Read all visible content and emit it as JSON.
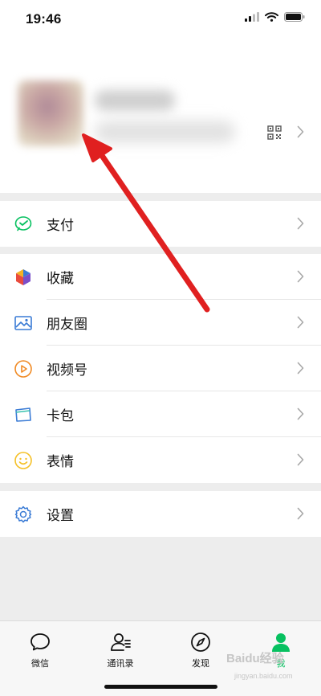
{
  "status_bar": {
    "time": "19:46",
    "icons": [
      "cellular-signal-icon",
      "wifi-icon",
      "battery-icon"
    ]
  },
  "profile": {
    "avatar": "blurred-avatar",
    "name_obscured": true,
    "icons": [
      "qr-code-icon",
      "chevron-right-icon"
    ]
  },
  "menu": {
    "pay": {
      "label": "支付",
      "icon": "wechat-pay-icon"
    },
    "favorites": {
      "label": "收藏",
      "icon": "favorites-cube-icon"
    },
    "moments": {
      "label": "朋友圈",
      "icon": "moments-image-icon"
    },
    "channels": {
      "label": "视频号",
      "icon": "channels-play-icon"
    },
    "cards": {
      "label": "卡包",
      "icon": "card-wallet-icon"
    },
    "stickers": {
      "label": "表情",
      "icon": "sticker-smile-icon"
    },
    "settings": {
      "label": "设置",
      "icon": "settings-gear-icon"
    }
  },
  "tabbar": {
    "chats": {
      "label": "微信",
      "icon": "chat-bubble-icon"
    },
    "contacts": {
      "label": "通讯录",
      "icon": "contacts-icon"
    },
    "discover": {
      "label": "发现",
      "icon": "compass-icon"
    },
    "me": {
      "label": "我",
      "icon": "person-icon",
      "active": true
    }
  },
  "watermark": {
    "text": "Baidu经验",
    "sub": "jingyan.baidu.com"
  },
  "annotation": {
    "type": "red-arrow",
    "points_to": "avatar"
  },
  "colors": {
    "accent_green": "#07c160",
    "arrow_red": "#e02020",
    "background_gray": "#ededed",
    "icon_blue": "#3a7bd5"
  }
}
